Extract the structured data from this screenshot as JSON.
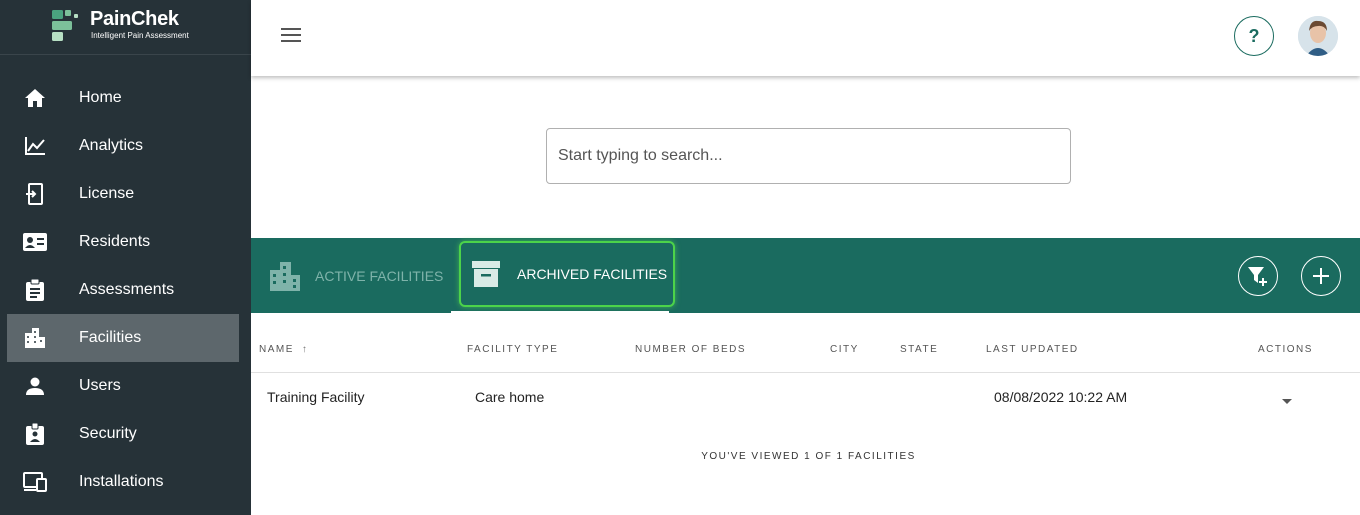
{
  "brand": {
    "name": "PainChek",
    "tagline": "Intelligent Pain Assessment",
    "color": "#1a6b5f"
  },
  "sidebar": {
    "items": [
      {
        "label": "Home",
        "icon": "home-icon"
      },
      {
        "label": "Analytics",
        "icon": "analytics-icon"
      },
      {
        "label": "License",
        "icon": "license-icon"
      },
      {
        "label": "Residents",
        "icon": "id-card-icon"
      },
      {
        "label": "Assessments",
        "icon": "clipboard-icon"
      },
      {
        "label": "Facilities",
        "icon": "building-icon",
        "active": true
      },
      {
        "label": "Users",
        "icon": "user-icon"
      },
      {
        "label": "Security",
        "icon": "badge-icon"
      },
      {
        "label": "Installations",
        "icon": "devices-icon"
      }
    ]
  },
  "header": {
    "help_label": "?"
  },
  "search": {
    "placeholder": "Start typing to search..."
  },
  "tabs": {
    "active_label": "ACTIVE FACILITIES",
    "archived_label": "ARCHIVED FACILITIES",
    "selected": "archived"
  },
  "table": {
    "columns": [
      "NAME",
      "FACILITY TYPE",
      "NUMBER OF BEDS",
      "CITY",
      "STATE",
      "LAST UPDATED",
      "ACTIONS"
    ],
    "rows": [
      {
        "name": "Training Facility",
        "facility_type": "Care home",
        "number_of_beds": "",
        "city": "",
        "state": "",
        "last_updated": "08/08/2022 10:22 AM"
      }
    ],
    "footer": "YOU'VE VIEWED 1 OF 1 FACILITIES"
  }
}
